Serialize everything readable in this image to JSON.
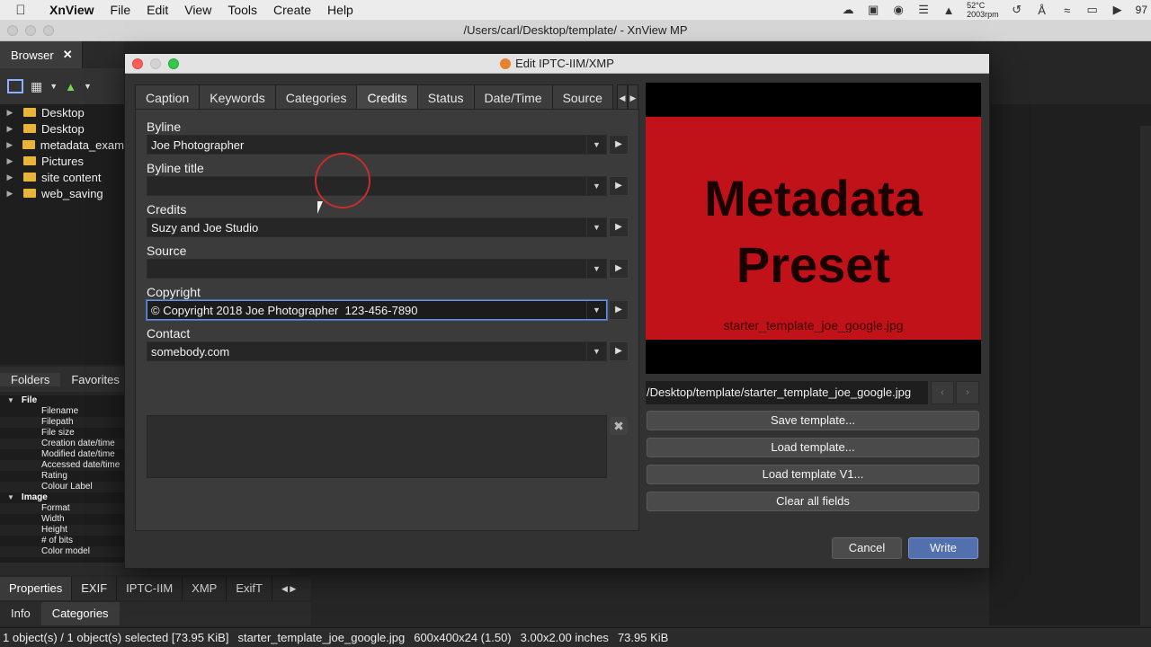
{
  "menubar": {
    "app": "XnView",
    "items": [
      "File",
      "Edit",
      "View",
      "Tools",
      "Create",
      "Help"
    ],
    "temp": "52°C",
    "rpm": "2003rpm",
    "battery_text": "97"
  },
  "window": {
    "title": "/Users/carl/Desktop/template/ - XnView MP"
  },
  "browser": {
    "tab_label": "Browser",
    "folders": [
      "Desktop",
      "Desktop",
      "metadata_exam",
      "Pictures",
      "site content",
      "web_saving"
    ],
    "panel_tabs": [
      "Folders",
      "Favorites"
    ],
    "properties": {
      "file_group": "File",
      "file_rows": [
        "Filename",
        "Filepath",
        "File size",
        "Creation date/time",
        "Modified date/time",
        "Accessed date/time",
        "Rating",
        "Colour Label"
      ],
      "image_group": "Image",
      "image_rows": [
        "Format",
        "Width",
        "Height",
        "# of bits",
        "Color model"
      ]
    },
    "bottom_tabs": [
      "Properties",
      "EXIF",
      "IPTC-IIM",
      "XMP",
      "ExifT"
    ],
    "info_tabs": [
      "Info",
      "Categories"
    ]
  },
  "status": {
    "selection": "1 object(s) / 1 object(s) selected [73.95 KiB]",
    "filename": "starter_template_joe_google.jpg",
    "dimensions": "600x400x24 (1.50)",
    "inches": "3.00x2.00 inches",
    "size": "73.95 KiB"
  },
  "dialog": {
    "title": "Edit IPTC-IIM/XMP",
    "tabs": [
      "Caption",
      "Keywords",
      "Categories",
      "Credits",
      "Status",
      "Date/Time",
      "Source"
    ],
    "active_tab": "Credits",
    "fields": {
      "byline": {
        "label": "Byline",
        "value": "Joe Photographer"
      },
      "byline_title": {
        "label": "Byline title",
        "value": ""
      },
      "credits": {
        "label": "Credits",
        "value": "Suzy and Joe Studio"
      },
      "source": {
        "label": "Source",
        "value": ""
      },
      "copyright": {
        "label": "Copyright",
        "value": "© Copyright 2018 Joe Photographer  123-456-7890"
      },
      "contact": {
        "label": "Contact",
        "value": "somebody.com"
      }
    },
    "preview": {
      "title_line1": "Metadata",
      "title_line2": "Preset",
      "filename": "starter_template_joe_google.jpg"
    },
    "path": "/Desktop/template/starter_template_joe_google.jpg",
    "buttons": {
      "save_template": "Save template...",
      "load_template": "Load template...",
      "load_template_v1": "Load template V1...",
      "clear_all": "Clear all fields",
      "cancel": "Cancel",
      "write": "Write"
    }
  }
}
